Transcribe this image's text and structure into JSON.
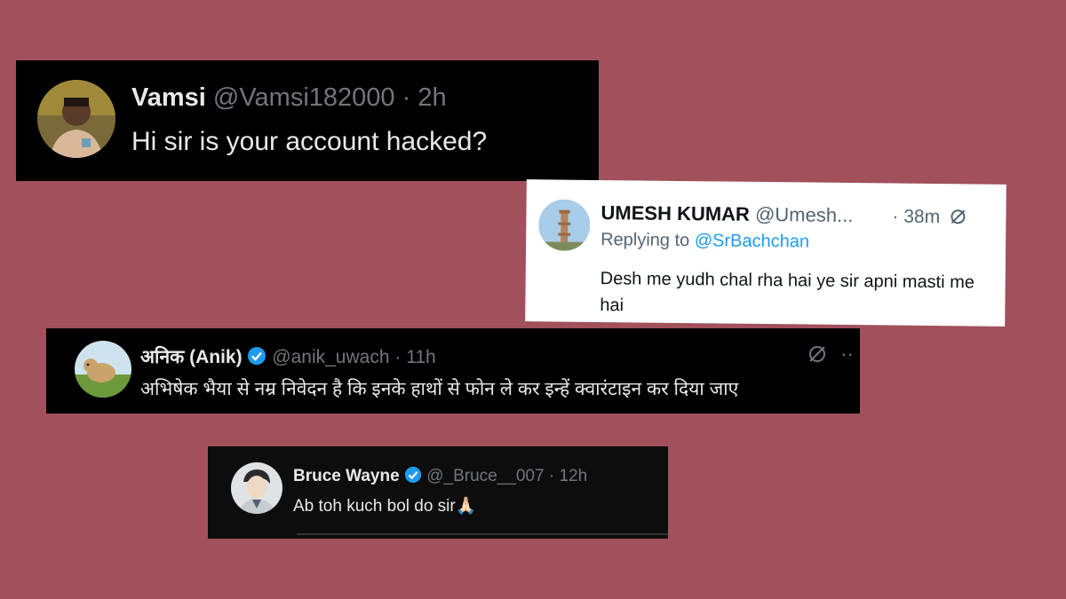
{
  "tweets": [
    {
      "name": "Vamsi",
      "handle": "@Vamsi182000",
      "separator": "·",
      "time": "2h",
      "text": "Hi sir is your account hacked?"
    },
    {
      "name": "UMESH KUMAR",
      "handle": "@Umesh...",
      "separator": "·",
      "time": "38m",
      "replying_prefix": "Replying to",
      "replying_to": "@SrBachchan",
      "text": "Desh me yudh chal rha hai ye sir apni masti me hai"
    },
    {
      "name": "अनिक (Anik)",
      "handle": "@anik_uwach",
      "separator": "·",
      "time": "11h",
      "more": "··",
      "text": "अभिषेक भैया से नम्र निवेदन है कि इनके हाथों से फोन ले कर इन्हें क्वारंटाइन कर दिया जाए"
    },
    {
      "name": "Bruce Wayne",
      "handle": "@_Bruce__007",
      "separator": "·",
      "time": "12h",
      "text": "Ab toh kuch bol do sir",
      "emoji": "🙏🏻"
    }
  ],
  "colors": {
    "background": "#a1505c",
    "verified": "#1d9bf0",
    "link": "#1d9bf0"
  },
  "icons": [
    "verified-badge-icon",
    "grok-icon",
    "more-icon"
  ]
}
